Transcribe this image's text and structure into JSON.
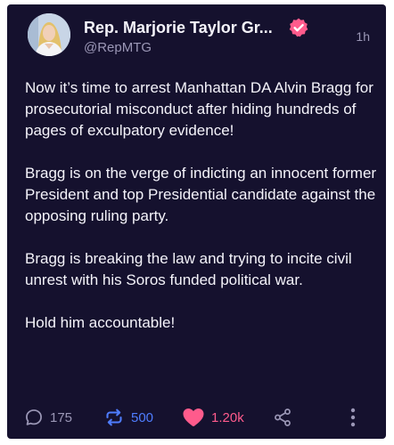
{
  "post": {
    "author": {
      "display_name": "Rep. Marjorie Taylor Gr...",
      "handle": "@RepMTG",
      "avatar_icon": "profile-avatar",
      "verified_icon": "verified-badge-icon"
    },
    "timestamp": "1h",
    "paragraphs": [
      "Now it’s time to arrest Manhattan DA Alvin Bragg for prosecutorial misconduct after hiding hundreds of pages of exculpatory evidence!",
      "Bragg is on the verge of indicting an innocent former President and top Presidential candidate against the opposing ruling party.",
      "Bragg is breaking the law and trying to incite civil unrest with his Soros funded political war.",
      "Hold him accountable!"
    ]
  },
  "actions": {
    "reply_count": "175",
    "repost_count": "500",
    "like_count": "1.20k",
    "icons": [
      "reply-icon",
      "repost-icon",
      "like-heart-icon",
      "share-icon",
      "more-options-icon"
    ]
  },
  "colors": {
    "background": "#15112e",
    "text": "#f4f3fa",
    "muted": "#9b97b6",
    "verified": "#ff5b8c",
    "repost": "#4f7dff",
    "like": "#ff5b8c"
  }
}
